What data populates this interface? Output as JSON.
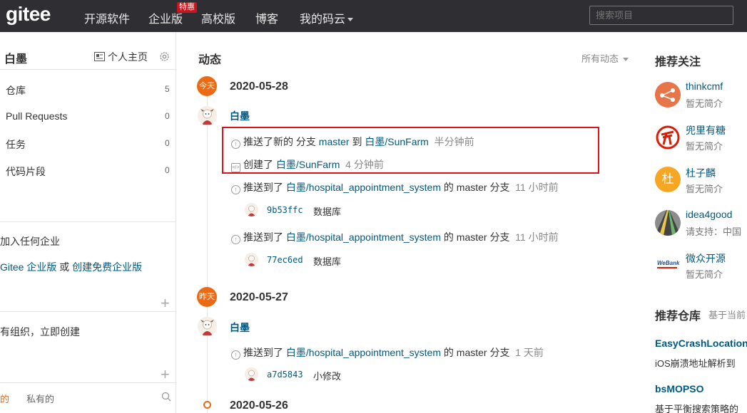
{
  "nav": {
    "logo": "gitee",
    "items": [
      "开源软件",
      "企业版",
      "高校版",
      "博客",
      "我的码云"
    ],
    "badge": "特惠",
    "search_placeholder": "搜索项目"
  },
  "sidebar": {
    "username": "白墨",
    "home_link": "个人主页",
    "stats": [
      {
        "label": "仓库",
        "count": "5"
      },
      {
        "label": "Pull Requests",
        "count": "0"
      },
      {
        "label": "任务",
        "count": "0"
      },
      {
        "label": "代码片段",
        "count": "0"
      }
    ],
    "enterprise_line1": "加入任何企业",
    "enterprise_link1": "Gitee 企业版",
    "enterprise_or": " 或 ",
    "enterprise_link2": "创建免费企业版",
    "org_text": "有组织，立即创建",
    "tab_mine": "的",
    "tab_private": "私有的"
  },
  "feed": {
    "title": "动态",
    "filter": "所有动态",
    "days": [
      {
        "badge": "今天",
        "date": "2020-05-28",
        "user": "白墨",
        "entries": [
          {
            "prefix": "推送了新的 分支 ",
            "branch": "master",
            "mid": " 到 ",
            "repo": "白墨/SunFarm",
            "suffix": "",
            "time": "半分钟前",
            "icon": "↑"
          },
          {
            "prefix": "创建了 ",
            "branch": "",
            "mid": "",
            "repo": "白墨/SunFarm",
            "suffix": "",
            "time": "4 分钟前",
            "icon": "</>"
          },
          {
            "prefix": "推送到了 ",
            "branch": "",
            "mid": "",
            "repo": "白墨/hospital_appointment_system",
            "suffix": " 的 master 分支",
            "time": "11 小时前",
            "icon": "↑",
            "commit_sha": "9b53ffc",
            "commit_msg": "数据库"
          },
          {
            "prefix": "推送到了 ",
            "branch": "",
            "mid": "",
            "repo": "白墨/hospital_appointment_system",
            "suffix": " 的 master 分支",
            "time": "11 小时前",
            "icon": "↑",
            "commit_sha": "77ec6ed",
            "commit_msg": "数据库"
          }
        ]
      },
      {
        "badge": "昨天",
        "date": "2020-05-27",
        "user": "白墨",
        "entries": [
          {
            "prefix": "推送到了 ",
            "repo": "白墨/hospital_appointment_system",
            "suffix": " 的 master 分支",
            "time": "1 天前",
            "icon": "↑",
            "commit_sha": "a7d5843",
            "commit_msg": "小修改"
          }
        ]
      },
      {
        "date": "2020-05-26"
      }
    ]
  },
  "right": {
    "follow_title": "推荐关注",
    "users": [
      {
        "name": "thinkcmf",
        "desc": "暂无简介",
        "avatar_color": "#e8754a"
      },
      {
        "name": "兜里有糖",
        "desc": "暂无简介",
        "avatar_color": "#d81e06"
      },
      {
        "name": "杜子麟",
        "desc": "暂无简介",
        "avatar_color": "#f5a623",
        "avatar_char": "杜"
      },
      {
        "name": "idea4good",
        "desc": "请支持：中国",
        "avatar_color": "#6b6b6b"
      },
      {
        "name": "微众开源",
        "desc": "暂无简介",
        "avatar_color": "#1a4f9c",
        "avatar_text": "WeBank"
      }
    ],
    "repo_title": "推荐仓库",
    "repo_sub": "基于当前",
    "repos": [
      {
        "name": "EasyCrashLocation",
        "desc": "iOS崩溃地址解析到"
      },
      {
        "name": "bsMOPSO",
        "desc": "基于平衡搜索策略的"
      }
    ]
  },
  "colors": {
    "nav_bg": "#2f2f33",
    "accent": "#ec6a13",
    "link": "#005980",
    "highlight": "#d9121b"
  }
}
